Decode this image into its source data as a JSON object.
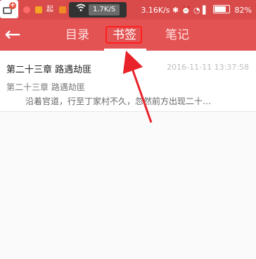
{
  "status_bar": {
    "app_badge_icon": "app-plus-icon",
    "left_mini_icons": [
      "weibo-icon",
      "app-icon",
      "app-icon"
    ],
    "mini_text": "起",
    "net_speed": "1.7K/S",
    "right_speed": "3.16K/s",
    "right_icons": [
      "bluetooth-icon",
      "alarm-icon",
      "wifi-icon",
      "signal-icon"
    ],
    "battery": "82%"
  },
  "header": {
    "back_icon": "back-arrow-icon",
    "tabs": [
      {
        "label": "目录"
      },
      {
        "label": "书签",
        "selected": true
      },
      {
        "label": "笔记"
      }
    ]
  },
  "bookmarks": [
    {
      "chapter": "第二十三章 路遇劫匪",
      "time": "2016-11-11 13:37:58",
      "subtitle": "第二十三章 路遇劫匪",
      "snippet": "沿着官道，行至丁家村不久，忽然前方出现二十…"
    }
  ],
  "colors": {
    "header_bg": "#e45353",
    "status_bg": "#d94a4a",
    "highlight_box": "#ff1f1f",
    "annotation_arrow": "#e8232a"
  }
}
